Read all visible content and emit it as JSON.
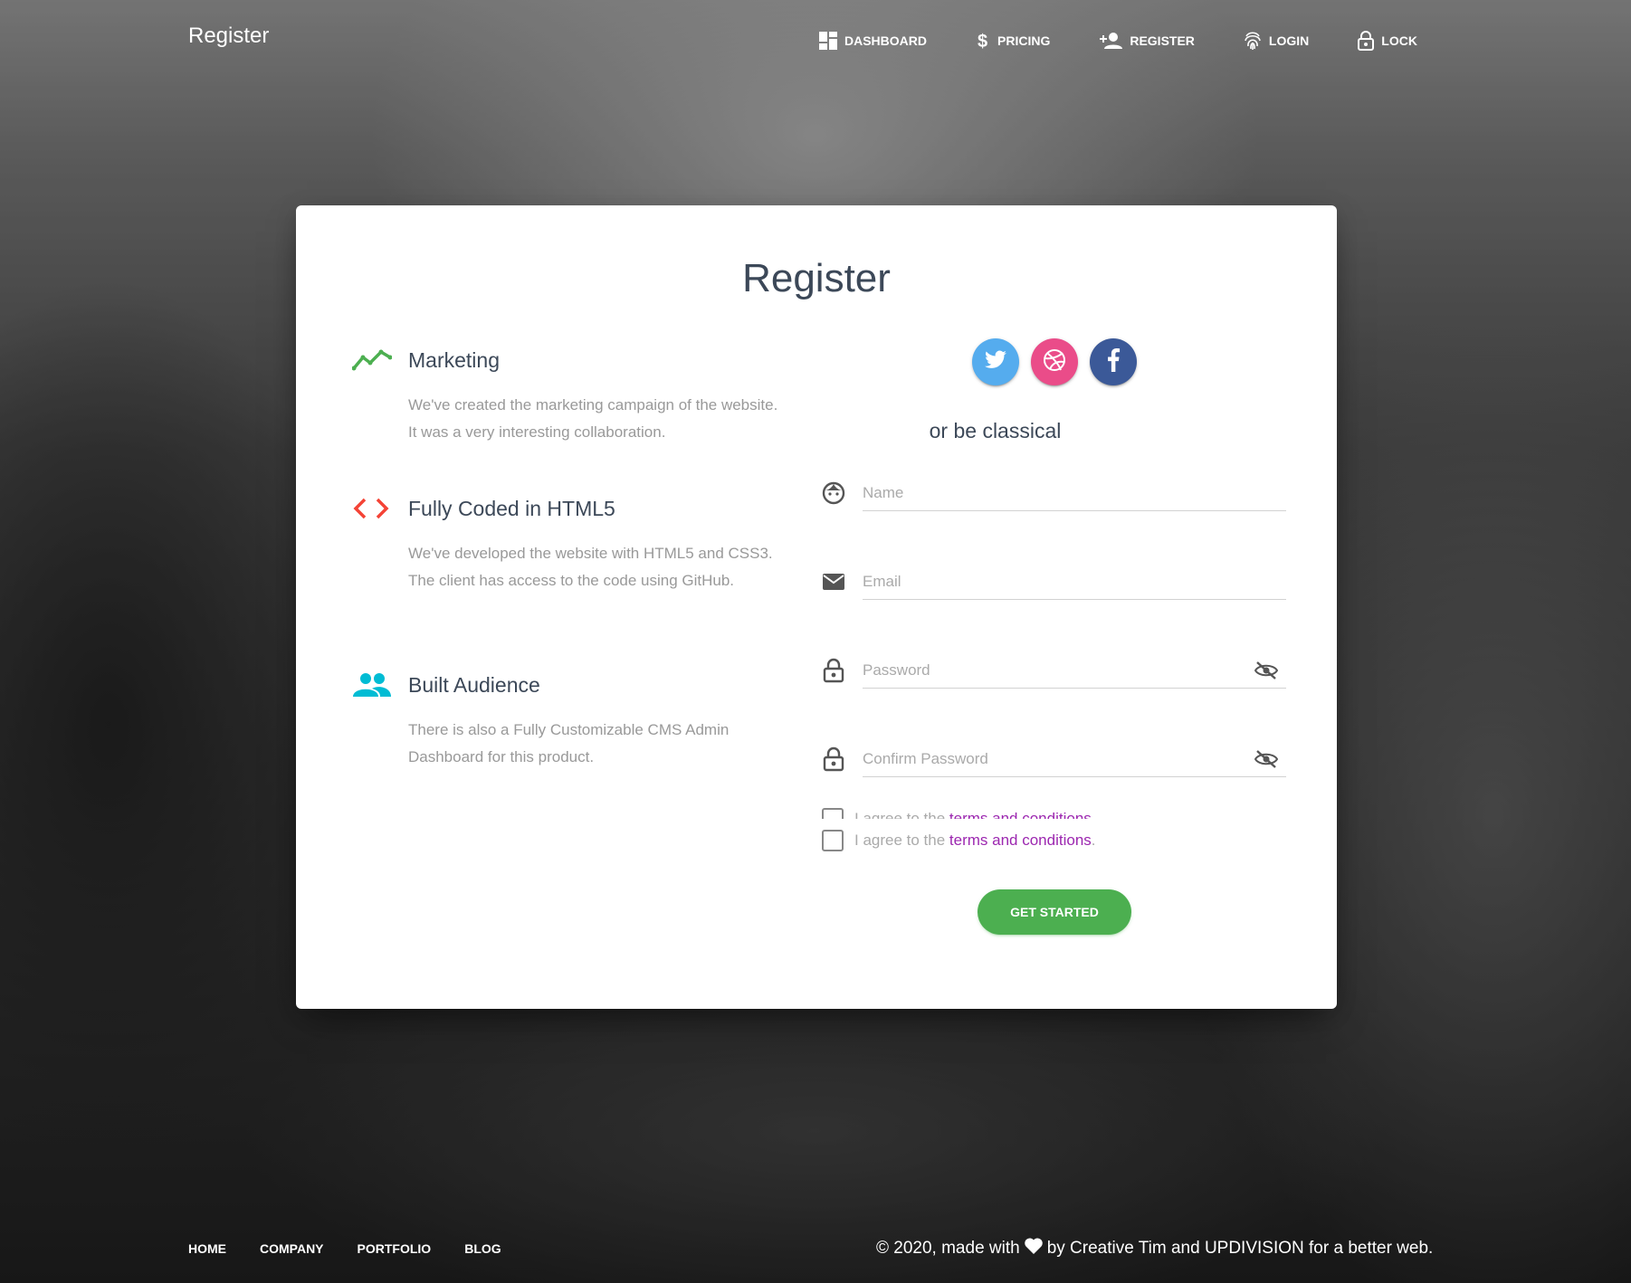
{
  "navbar": {
    "brand": "Register",
    "items": [
      {
        "label": "Dashboard",
        "icon": "dashboard-icon"
      },
      {
        "label": "Pricing",
        "icon": "dollar-icon"
      },
      {
        "label": "Register",
        "icon": "person-add-icon"
      },
      {
        "label": "Login",
        "icon": "fingerprint-icon"
      },
      {
        "label": "Lock",
        "icon": "lock-icon"
      }
    ]
  },
  "card": {
    "title": "Register",
    "info": [
      {
        "title": "Marketing",
        "desc": "We've created the marketing campaign of the website. It was a very interesting collaboration.",
        "icon": "timeline-icon",
        "color": "#4caf50"
      },
      {
        "title": "Fully Coded in HTML5",
        "desc": "We've developed the website with HTML5 and CSS3. The client has access to the code using GitHub.",
        "icon": "code-icon",
        "color": "#f44336"
      },
      {
        "title": "Built Audience",
        "desc": "There is also a Fully Customizable CMS Admin Dashboard for this product.",
        "icon": "group-icon",
        "color": "#00bcd4"
      }
    ],
    "socials": [
      {
        "name": "twitter",
        "color": "#55acee"
      },
      {
        "name": "dribbble",
        "color": "#ea4c89"
      },
      {
        "name": "facebook",
        "color": "#3b5998"
      }
    ],
    "or_text": "or be classical",
    "fields": {
      "name": {
        "placeholder": "Name",
        "value": ""
      },
      "email": {
        "placeholder": "Email",
        "value": ""
      },
      "password": {
        "placeholder": "Password",
        "value": ""
      },
      "confirm": {
        "placeholder": "Confirm Password",
        "value": ""
      }
    },
    "terms": {
      "prefix": "I agree to the",
      "link": "terms and conditions",
      "suffix": ".",
      "checked": false
    },
    "cta_label": "Get Started"
  },
  "footer": {
    "links": [
      "Home",
      "Company",
      "Portfolio",
      "Blog"
    ],
    "copyright_prefix": "© 2020, made with",
    "copyright_suffix": "by Creative Tim and UPDIVISION for a better web."
  }
}
